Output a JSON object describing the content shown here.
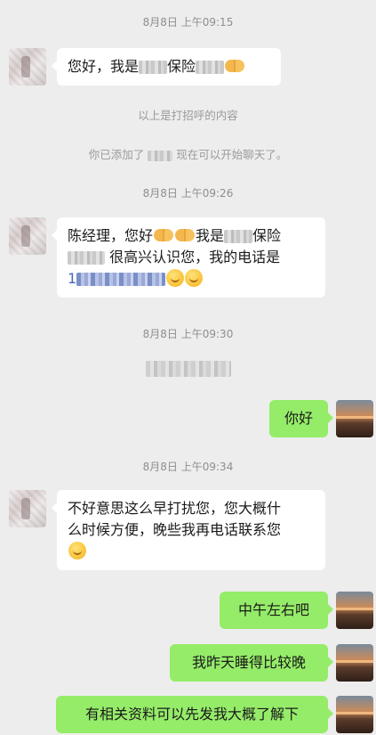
{
  "messages": {
    "ts1": "8月8日 上午09:15",
    "m1_a": "您好，我是",
    "m1_b": "保险",
    "sys1": "以上是打招呼的内容",
    "sys2_a": "你已添加了",
    "sys2_b": "现在可以开始聊天了。",
    "ts2": "8月8日 上午09:26",
    "m2_line1_a": "陈经理，您好",
    "m2_line1_b": "我是",
    "m2_line1_c": "保险",
    "m2_line2": "很高兴认识您，我的电话是",
    "m2_line3_prefix": "1",
    "ts3": "8月8日 上午09:30",
    "m3": "你好",
    "ts4": "8月8日 上午09:34",
    "m4_line1": "不好意思这么早打扰您，您大概什",
    "m4_line2": "么时候方便，晚些我再电话联系您",
    "m5": "中午左右吧",
    "m6": "我昨天睡得比较晚",
    "m7": "有相关资料可以先发我大概了解下"
  },
  "icons": {
    "smile": "smile-emoji",
    "handshake": "handshake-emoji"
  },
  "colors": {
    "background": "#ededed",
    "bubble_incoming": "#ffffff",
    "bubble_outgoing": "#95ec69"
  }
}
